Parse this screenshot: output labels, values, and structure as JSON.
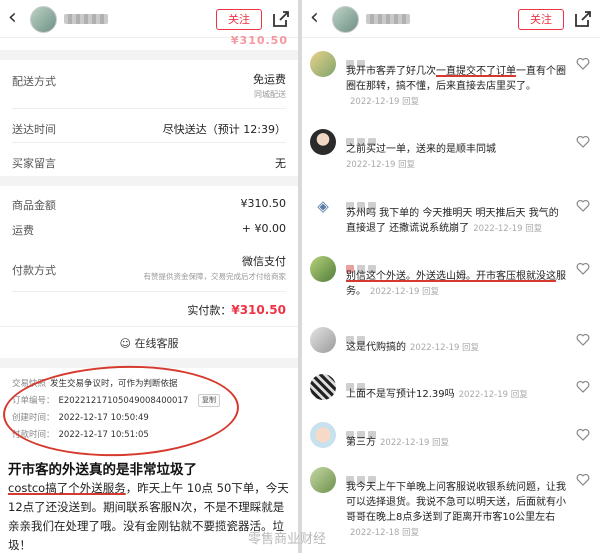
{
  "left": {
    "header": {
      "follow_label": "关注"
    },
    "top_price": "¥310.50",
    "rows": [
      {
        "label": "配送方式",
        "value": "免运费",
        "sub": "同城配送"
      },
      {
        "label": "送达时间",
        "value": "尽快送达（预计 12:39）"
      },
      {
        "label": "买家留言",
        "value": "无"
      }
    ],
    "amounts": [
      {
        "label": "商品金额",
        "value": "¥310.50"
      },
      {
        "label": "运费",
        "value": "+ ¥0.00"
      }
    ],
    "payment": {
      "label": "付款方式",
      "value": "微信支付",
      "note": "有赞提供资金保障，交易完成后才付给商家"
    },
    "total_label": "实付款：",
    "total_value": "¥310.50",
    "service_label": "在线客服",
    "info": [
      {
        "label": "交易快照",
        "value": "发生交易争议时，可作为判断依据"
      },
      {
        "label": "订单编号：",
        "value": "E20221217105049008400017"
      },
      {
        "label": "创建时间：",
        "value": "2022-12-17 10:50:49"
      },
      {
        "label": "付款时间：",
        "value": "2022-12-17 10:51:05"
      }
    ],
    "copy_label": "复制",
    "caption_title": "开市客的外送真的是非常垃圾了",
    "caption_underlined": "costco搞了个外送服务",
    "caption_rest": "，昨天上午 10点 50下单，今天 12点了还没送到。期间联系客服N次，不是不理睬就是亲亲我们在处理了哦。没有金刚钻就不要揽瓷器活。垃圾！"
  },
  "right": {
    "header": {
      "follow_label": "关注"
    },
    "comments": [
      {
        "pre": "我开市客弄了好几次",
        "underlined": "一直提交不了订单",
        "post": "一直有个圈圈在那转，搞不懂，后来直接去店里买了。",
        "date": "2022-12-19",
        "reply": "回复",
        "avatar": "a1"
      },
      {
        "pre": "之前买过一单，送来的是顺丰同城",
        "underlined": "",
        "post": "",
        "date": "2022-12-19",
        "reply": "回复",
        "avatar": "a2"
      },
      {
        "pre": "苏州吗 我下单的 今天推明天 明天推后天 我气的直接退了 还撒谎说系统崩了",
        "underlined": "",
        "post": "",
        "date": "2022-12-19",
        "reply": "回复",
        "avatar": "a3"
      },
      {
        "pre": "",
        "underlined": "别信这个外送。外送选山姆。开市客压根就没这",
        "post": "服务。",
        "date": "2022-12-19",
        "reply": "回复",
        "avatar": "a4"
      },
      {
        "pre": "这是代购搞的",
        "underlined": "",
        "post": "",
        "date": "2022-12-19",
        "reply": "回复",
        "avatar": "a5"
      },
      {
        "pre": "上面不是写预计12.39吗",
        "underlined": "",
        "post": "",
        "date": "2022-12-19",
        "reply": "回复",
        "avatar": "a6"
      },
      {
        "pre": "第三方",
        "underlined": "",
        "post": "",
        "date": "2022-12-19",
        "reply": "回复",
        "avatar": "a7"
      },
      {
        "pre": "我今天上午下单晚上问客服说收银系统问题，让我可以选择退货。我说不急可以明天送，后面就有小哥哥在晚上8点多送到了距离开市客10公里左右",
        "underlined": "",
        "post": "",
        "date": "2022-12-18",
        "reply": "回复",
        "avatar": "a8"
      }
    ]
  },
  "watermark": "零售商业财经",
  "colors": {
    "accent": "#ee3344",
    "annotation": "#d63a2e"
  }
}
